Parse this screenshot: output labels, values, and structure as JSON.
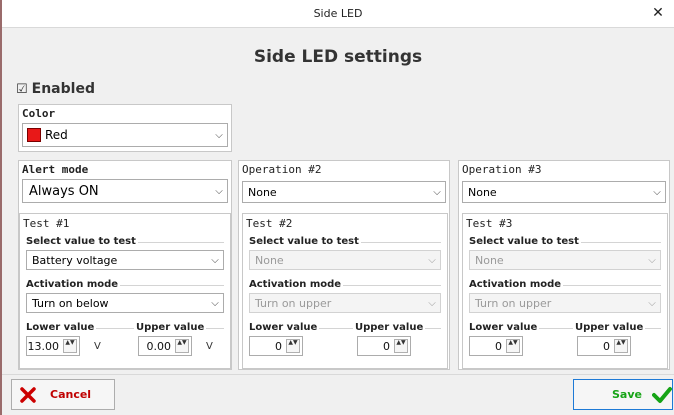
{
  "window": {
    "title": "Side LED",
    "close_glyph": "✕"
  },
  "page_title": "Side LED settings",
  "enabled": {
    "checked": true,
    "label": "Enabled",
    "glyph": "☑"
  },
  "color": {
    "title": "Color",
    "value": "Red",
    "swatch": "#e81818"
  },
  "alert_mode": {
    "title": "Alert mode",
    "value": "Always ON"
  },
  "operations": [
    {
      "title": "Operation #2",
      "value": "None"
    },
    {
      "title": "Operation #3",
      "value": "None"
    }
  ],
  "tests": [
    {
      "title": "Test #1",
      "select_label": "Select value to test",
      "select_value": "Battery voltage",
      "activation_label": "Activation mode",
      "activation_value": "Turn on below",
      "lower_label": "Lower value",
      "upper_label": "Upper value",
      "lower_value": "13.00",
      "upper_value": "0.00",
      "lower_unit": "V",
      "upper_unit": "V",
      "enabled": true
    },
    {
      "title": "Test #2",
      "select_label": "Select value to test",
      "select_value": "None",
      "activation_label": "Activation mode",
      "activation_value": "Turn on upper",
      "lower_label": "Lower value",
      "upper_label": "Upper value",
      "lower_value": "0",
      "upper_value": "0",
      "enabled": false
    },
    {
      "title": "Test #3",
      "select_label": "Select value to test",
      "select_value": "None",
      "activation_label": "Activation mode",
      "activation_value": "Turn on upper",
      "lower_label": "Lower value",
      "upper_label": "Upper value",
      "lower_value": "0",
      "upper_value": "0",
      "enabled": false
    }
  ],
  "chevron_glyph": "⌵",
  "spinner_glyph": "▲▼",
  "buttons": {
    "cancel": {
      "label": "Cancel",
      "icon": "x-icon",
      "color": "#c00000"
    },
    "save": {
      "label": "Save",
      "icon": "check-icon",
      "color": "#16a416"
    }
  },
  "colors": {
    "accent_border": "#1e7ad6",
    "cancel_red": "#cc0000",
    "save_green": "#16a416"
  }
}
